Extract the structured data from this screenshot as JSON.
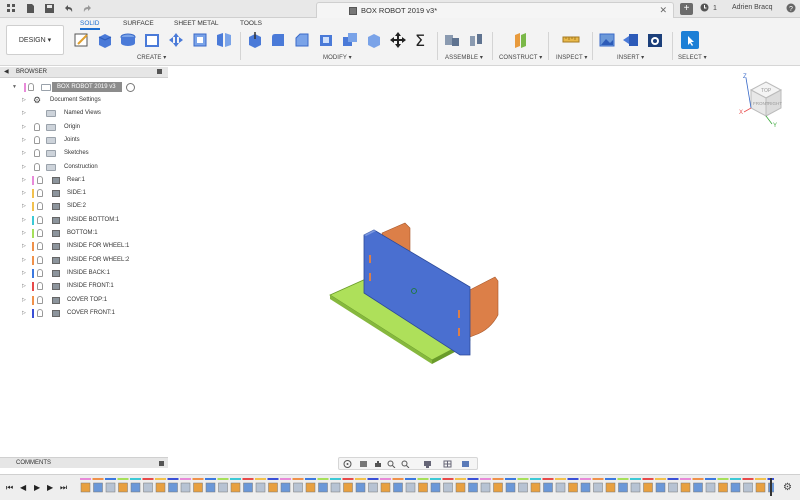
{
  "app": {
    "doc_title": "BOX ROBOT 2019 v3*",
    "user_name": "Adrien Bracq",
    "notif_count": "1"
  },
  "toolbar": {
    "design_label": "DESIGN",
    "tabs": [
      "SOLID",
      "SURFACE",
      "SHEET METAL",
      "TOOLS"
    ],
    "active_tab": "SOLID",
    "groups": [
      "CREATE ▾",
      "MODIFY ▾",
      "ASSEMBLE ▾",
      "CONSTRUCT ▾",
      "INSPECT ▾",
      "INSERT ▾",
      "SELECT ▾"
    ]
  },
  "browser": {
    "header": "BROWSER",
    "root": "BOX ROBOT 2019 v3",
    "items": [
      {
        "label": "Document Settings",
        "kind": "gear",
        "color": ""
      },
      {
        "label": "Named Views",
        "kind": "folder",
        "color": ""
      },
      {
        "label": "Origin",
        "kind": "folder",
        "color": ""
      },
      {
        "label": "Joints",
        "kind": "folder",
        "color": ""
      },
      {
        "label": "Sketches",
        "kind": "folder",
        "color": ""
      },
      {
        "label": "Construction",
        "kind": "folder",
        "color": ""
      },
      {
        "label": "Rear:1",
        "kind": "body",
        "color": "#e88ad9"
      },
      {
        "label": "SIDE:1",
        "kind": "body",
        "color": "#f2c14e"
      },
      {
        "label": "SIDE:2",
        "kind": "body",
        "color": "#f2c14e"
      },
      {
        "label": "INSIDE BOTTOM:1",
        "kind": "body",
        "color": "#3cc9d6"
      },
      {
        "label": "BOTTOM:1",
        "kind": "body",
        "color": "#a6e05a"
      },
      {
        "label": "INSIDE FOR WHEEL:1",
        "kind": "body",
        "color": "#f0914a"
      },
      {
        "label": "INSIDE FOR WHEEL:2",
        "kind": "body",
        "color": "#f0914a"
      },
      {
        "label": "INSIDE BACK:1",
        "kind": "body",
        "color": "#3b78e0"
      },
      {
        "label": "INSIDE FRONT:1",
        "kind": "body",
        "color": "#e84a4a"
      },
      {
        "label": "COVER TOP:1",
        "kind": "body",
        "color": "#f0914a"
      },
      {
        "label": "COVER FRONT:1",
        "kind": "body",
        "color": "#3a4fd6"
      }
    ]
  },
  "comments": {
    "header": "COMMENTS"
  },
  "viewcube": {
    "top": "TOP",
    "front": "FRONT",
    "right": "RIGHT",
    "axis_z": "Z",
    "axis_x": "X",
    "axis_y": "Y"
  },
  "colors": {
    "panel_blue": "#4a6fd0",
    "panel_orange": "#dc7f48",
    "panel_green": "#aee05a",
    "accent": "#1c6fd1"
  }
}
